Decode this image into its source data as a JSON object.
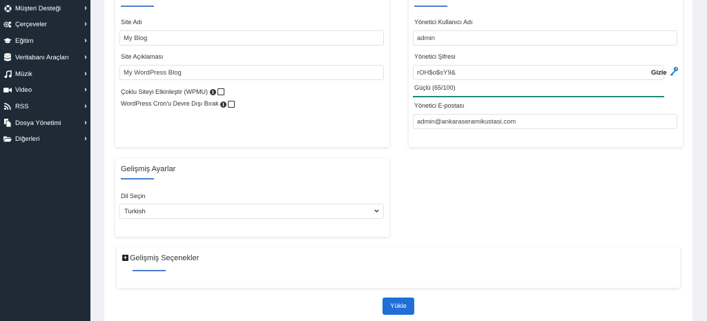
{
  "sidebar": {
    "items": [
      {
        "label": "Müşteri Desteği",
        "icon": "life-ring-icon"
      },
      {
        "label": "Çerçeveler",
        "icon": "cogs-icon"
      },
      {
        "label": "Eğitim",
        "icon": "graduation-cap-icon"
      },
      {
        "label": "Veritabanı Araçları",
        "icon": "database-icon"
      },
      {
        "label": "Müzik",
        "icon": "music-icon"
      },
      {
        "label": "Video",
        "icon": "video-icon"
      },
      {
        "label": "RSS",
        "icon": "rss-icon"
      },
      {
        "label": "Dosya Yönetimi",
        "icon": "file-icon"
      },
      {
        "label": "Diğerleri",
        "icon": "folder-icon"
      }
    ],
    "chevron": "›"
  },
  "site": {
    "name_label": "Site Adı",
    "name_value": "My Blog",
    "desc_label": "Site Açıklaması",
    "desc_value": "My WordPress Blog",
    "wpmu_label": "Çoklu Siteyi Etkinleştir (WPMU)",
    "cron_label": "WordPress Cron'u Devre Dışı Bırak",
    "info_glyph": "i"
  },
  "admin": {
    "username_label": "Yönetici Kullanıcı Adı",
    "username_value": "admin",
    "password_label": "Yönetici Şifresi",
    "password_value": "rOH$o$sY9&",
    "hide_label": "Gizle",
    "strength_text": "Güçlü (65/100)",
    "strength_percent": 65,
    "email_label": "Yönetici E-postası",
    "email_value": "admin@ankaraseramikustasi.com"
  },
  "advanced_settings": {
    "title": "Gelişmiş Ayarlar",
    "language_label": "Dil Seçin",
    "language_value": "Turkish"
  },
  "advanced_options": {
    "title": "Gelişmiş Seçenekler",
    "toggle_glyph": "+"
  },
  "install_button": "Yükle",
  "colors": {
    "sidebar_bg": "#1e2b37",
    "accent": "#1f6fd6",
    "strength_bar": "#1e8a7a"
  }
}
